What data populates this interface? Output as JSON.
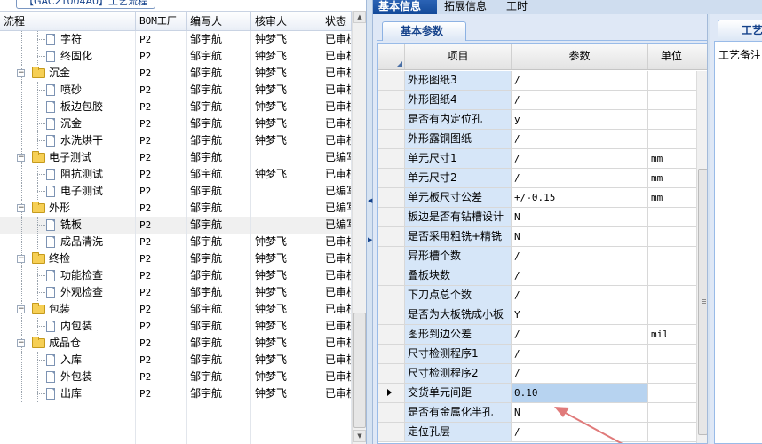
{
  "left_panel": {
    "tab_label": "【GAC21004A0】工艺流程",
    "columns": [
      "流程",
      "BOM工厂",
      "编写人",
      "核审人",
      "状态"
    ],
    "rows": [
      {
        "name": "字符",
        "level": 2,
        "type": "doc",
        "bom": "P2",
        "writer": "邹宇航",
        "reviewer": "钟梦飞",
        "status": "已审核"
      },
      {
        "name": "终固化",
        "level": 2,
        "type": "doc",
        "bom": "P2",
        "writer": "邹宇航",
        "reviewer": "钟梦飞",
        "status": "已审核"
      },
      {
        "name": "沉金",
        "level": 1,
        "type": "folder",
        "bom": "P2",
        "writer": "邹宇航",
        "reviewer": "钟梦飞",
        "status": "已审核"
      },
      {
        "name": "喷砂",
        "level": 2,
        "type": "doc",
        "bom": "P2",
        "writer": "邹宇航",
        "reviewer": "钟梦飞",
        "status": "已审核"
      },
      {
        "name": "板边包胶",
        "level": 2,
        "type": "doc",
        "bom": "P2",
        "writer": "邹宇航",
        "reviewer": "钟梦飞",
        "status": "已审核"
      },
      {
        "name": "沉金",
        "level": 2,
        "type": "doc",
        "bom": "P2",
        "writer": "邹宇航",
        "reviewer": "钟梦飞",
        "status": "已审核"
      },
      {
        "name": "水洗烘干",
        "level": 2,
        "type": "doc",
        "bom": "P2",
        "writer": "邹宇航",
        "reviewer": "钟梦飞",
        "status": "已审核"
      },
      {
        "name": "电子测试",
        "level": 1,
        "type": "folder",
        "bom": "P2",
        "writer": "邹宇航",
        "reviewer": "",
        "status": "已编写"
      },
      {
        "name": "阻抗测试",
        "level": 2,
        "type": "doc",
        "bom": "P2",
        "writer": "邹宇航",
        "reviewer": "钟梦飞",
        "status": "已审核"
      },
      {
        "name": "电子测试",
        "level": 2,
        "type": "doc",
        "bom": "P2",
        "writer": "邹宇航",
        "reviewer": "",
        "status": "已编写"
      },
      {
        "name": "外形",
        "level": 1,
        "type": "folder",
        "bom": "P2",
        "writer": "邹宇航",
        "reviewer": "",
        "status": "已编写"
      },
      {
        "name": "铣板",
        "level": 2,
        "type": "doc",
        "bom": "P2",
        "writer": "邹宇航",
        "reviewer": "",
        "status": "已编写",
        "selected": true
      },
      {
        "name": "成品清洗",
        "level": 2,
        "type": "doc",
        "bom": "P2",
        "writer": "邹宇航",
        "reviewer": "钟梦飞",
        "status": "已审核"
      },
      {
        "name": "终检",
        "level": 1,
        "type": "folder",
        "bom": "P2",
        "writer": "邹宇航",
        "reviewer": "钟梦飞",
        "status": "已审核"
      },
      {
        "name": "功能检查",
        "level": 2,
        "type": "doc",
        "bom": "P2",
        "writer": "邹宇航",
        "reviewer": "钟梦飞",
        "status": "已审核"
      },
      {
        "name": "外观检查",
        "level": 2,
        "type": "doc",
        "bom": "P2",
        "writer": "邹宇航",
        "reviewer": "钟梦飞",
        "status": "已审核"
      },
      {
        "name": "包装",
        "level": 1,
        "type": "folder",
        "bom": "P2",
        "writer": "邹宇航",
        "reviewer": "钟梦飞",
        "status": "已审核"
      },
      {
        "name": "内包装",
        "level": 2,
        "type": "doc",
        "bom": "P2",
        "writer": "邹宇航",
        "reviewer": "钟梦飞",
        "status": "已审核"
      },
      {
        "name": "成品仓",
        "level": 1,
        "type": "folder",
        "bom": "P2",
        "writer": "邹宇航",
        "reviewer": "钟梦飞",
        "status": "已审核"
      },
      {
        "name": "入库",
        "level": 2,
        "type": "doc",
        "bom": "P2",
        "writer": "邹宇航",
        "reviewer": "钟梦飞",
        "status": "已审核"
      },
      {
        "name": "外包装",
        "level": 2,
        "type": "doc",
        "bom": "P2",
        "writer": "邹宇航",
        "reviewer": "钟梦飞",
        "status": "已审核"
      },
      {
        "name": "出库",
        "level": 2,
        "type": "doc",
        "bom": "P2",
        "writer": "邹宇航",
        "reviewer": "钟梦飞",
        "status": "已审核"
      }
    ]
  },
  "right_tabs": [
    "基本信息",
    "拓展信息",
    "工时"
  ],
  "params_panel": {
    "tab_label": "基本参数",
    "columns": [
      "项目",
      "参数",
      "单位"
    ],
    "rows": [
      {
        "item": "外形图纸3",
        "param": "/",
        "unit": ""
      },
      {
        "item": "外形图纸4",
        "param": "/",
        "unit": ""
      },
      {
        "item": "是否有内定位孔",
        "param": "y",
        "unit": ""
      },
      {
        "item": "外形露铜图纸",
        "param": "/",
        "unit": ""
      },
      {
        "item": "单元尺寸1",
        "param": "/",
        "unit": "mm"
      },
      {
        "item": "单元尺寸2",
        "param": "/",
        "unit": "mm"
      },
      {
        "item": "单元板尺寸公差",
        "param": "+/-0.15",
        "unit": "mm"
      },
      {
        "item": "板边是否有钻槽设计",
        "param": "N",
        "unit": ""
      },
      {
        "item": "是否采用粗铣+精铣",
        "param": "N",
        "unit": ""
      },
      {
        "item": "异形槽个数",
        "param": "/",
        "unit": ""
      },
      {
        "item": "叠板块数",
        "param": "/",
        "unit": ""
      },
      {
        "item": "下刀点总个数",
        "param": "/",
        "unit": ""
      },
      {
        "item": "是否为大板铣成小板",
        "param": "Y",
        "unit": ""
      },
      {
        "item": "图形到边公差",
        "param": "/",
        "unit": "mil"
      },
      {
        "item": "尺寸检测程序1",
        "param": "/",
        "unit": ""
      },
      {
        "item": "尺寸检测程序2",
        "param": "/",
        "unit": ""
      },
      {
        "item": "交货单元间距",
        "param": "0.10",
        "unit": "",
        "current": true
      },
      {
        "item": "是否有金属化半孔",
        "param": "N",
        "unit": ""
      },
      {
        "item": "定位孔层",
        "param": "/",
        "unit": ""
      }
    ]
  },
  "far_panel": {
    "tab_label": "工艺备注",
    "label": "工艺备注"
  },
  "colors": {
    "accent": "#15428b",
    "item_cell": "#d6e6f8",
    "current_cell": "#b7d3f0",
    "annotation_arrow": "#e07a7a"
  }
}
